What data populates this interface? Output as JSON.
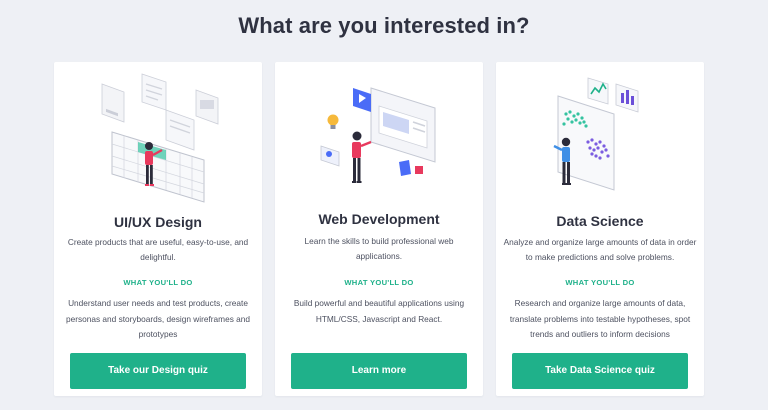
{
  "header": {
    "title": "What are you interested in?"
  },
  "colors": {
    "accent": "#1fb18a",
    "title_text": "#2f3241",
    "body_text": "#4d5160",
    "background": "#eef0f5",
    "card": "#ffffff"
  },
  "cards": [
    {
      "title": "UI/UX Design",
      "description": "Create products that are useful, easy-to-use, and delightful.",
      "subheading": "WHAT YOU'LL DO",
      "detail": "Understand user needs and test products, create personas and storyboards, design wireframes and prototypes",
      "button_label": "Take our Design quiz",
      "illustration_icon": "ui-ux-design-illustration-icon"
    },
    {
      "title": "Web Development",
      "description": "Learn the skills to build professional web applications.",
      "subheading": "WHAT YOU'LL DO",
      "detail": "Build powerful and beautiful applications using HTML/CSS, Javascript and React.",
      "button_label": "Learn more",
      "illustration_icon": "web-development-illustration-icon"
    },
    {
      "title": "Data Science",
      "description": "Analyze and organize large amounts of data in order to make predictions and solve problems.",
      "subheading": "WHAT YOU'LL DO",
      "detail": "Research and organize large amounts of data, translate problems into testable hypotheses, spot trends and outliers to inform decisions",
      "button_label": "Take Data Science quiz",
      "illustration_icon": "data-science-illustration-icon"
    }
  ]
}
